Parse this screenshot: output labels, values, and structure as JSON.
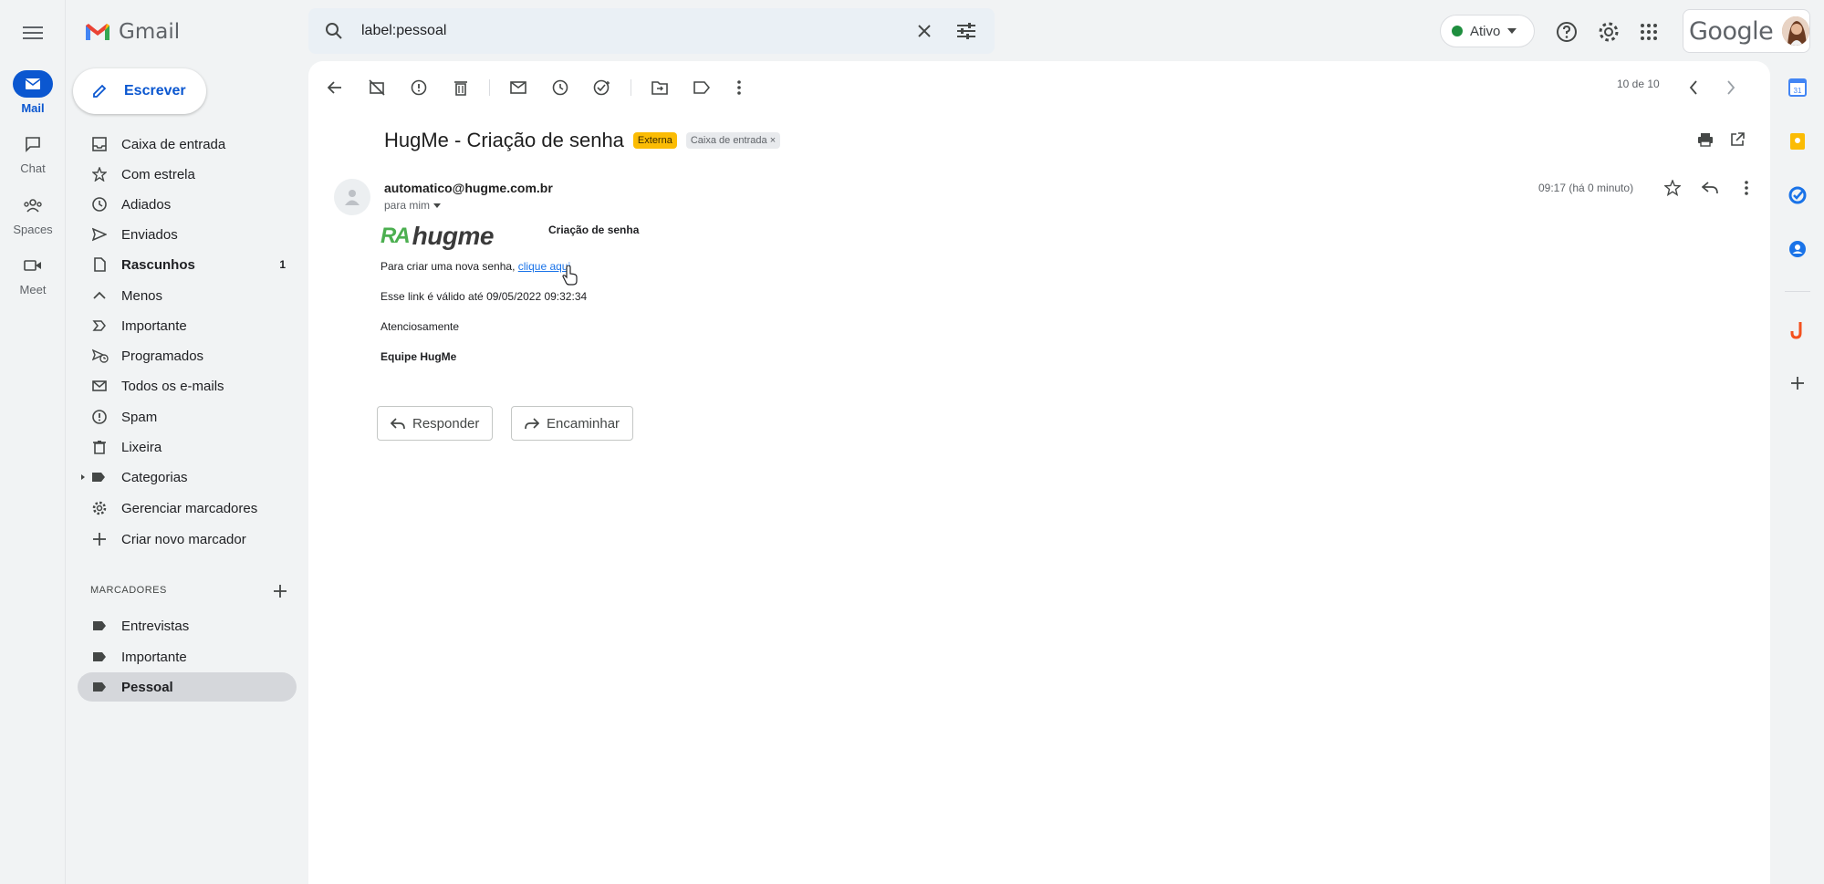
{
  "app": {
    "name": "Gmail"
  },
  "search": {
    "query": "label:pessoal"
  },
  "status": {
    "label": "Ativo"
  },
  "brand": {
    "account_word": "Google"
  },
  "rail": [
    {
      "label": "Mail"
    },
    {
      "label": "Chat"
    },
    {
      "label": "Spaces"
    },
    {
      "label": "Meet"
    }
  ],
  "compose": {
    "label": "Escrever"
  },
  "nav": [
    {
      "label": "Caixa de entrada"
    },
    {
      "label": "Com estrela"
    },
    {
      "label": "Adiados"
    },
    {
      "label": "Enviados"
    },
    {
      "label": "Rascunhos",
      "count": "1"
    },
    {
      "label": "Menos"
    },
    {
      "label": "Importante"
    },
    {
      "label": "Programados"
    },
    {
      "label": "Todos os e-mails"
    },
    {
      "label": "Spam"
    },
    {
      "label": "Lixeira"
    },
    {
      "label": "Categorias"
    },
    {
      "label": "Gerenciar marcadores"
    },
    {
      "label": "Criar novo marcador"
    }
  ],
  "labels": {
    "heading": "MARCADORES",
    "items": [
      {
        "label": "Entrevistas"
      },
      {
        "label": "Importante"
      },
      {
        "label": "Pessoal"
      }
    ]
  },
  "toolbar": {
    "counter": "10 de 10"
  },
  "message": {
    "subject": "HugMe - Criação de senha",
    "tag_external": "Externa",
    "tag_inbox": "Caixa de entrada",
    "tag_inbox_close": "×",
    "sender": "automatico@hugme.com.br",
    "recipient": "para mim",
    "time": "09:17 (há 0 minuto)",
    "logo_text": "hugme",
    "logo_mark": "RA",
    "email_title": "Criação de senha",
    "line1_prefix": "Para criar uma nova senha,",
    "line1_link": "clique aqui",
    "line2": "Esse link é válido até 09/05/2022 09:32:34",
    "line3": "Atenciosamente",
    "signature": "Equipe HugMe"
  },
  "actions": {
    "reply": "Responder",
    "forward": "Encaminhar"
  },
  "colors": {
    "accent": "#0b57d0",
    "tag_external": "#fbbc04",
    "status_green": "#1e8e3e",
    "link": "#1a73e8"
  }
}
